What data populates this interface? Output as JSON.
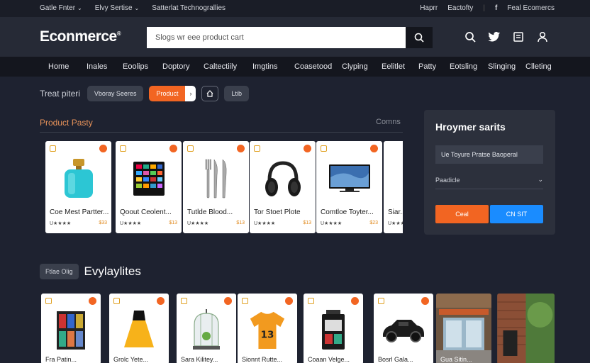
{
  "topbar": {
    "left": [
      {
        "label": "Gatle Fnter",
        "chevron": true
      },
      {
        "label": "Elvy Sertise",
        "chevron": true
      },
      {
        "label": "Satterlat Technograllies",
        "chevron": false
      }
    ],
    "right": {
      "link1": "Haprr",
      "link2": "Eactofty",
      "social": "Feal Ecomercs"
    }
  },
  "header": {
    "logo": "Econmerce",
    "logo_mark": "®",
    "search_placeholder": "Slogs wr eee product cart",
    "icons": [
      "search-icon",
      "twitter-icon",
      "cart-icon",
      "user-icon"
    ]
  },
  "nav": [
    "Home",
    "Inales",
    "Eoolips",
    "Doptory",
    "Caltectiily",
    "Imgtins",
    "Coasetood",
    "Clyping",
    "Eelitlet",
    "Patty",
    "Eotsling",
    "Slinging",
    "Clleting"
  ],
  "filters": {
    "label": "Treat piteri",
    "chips": [
      "Vboray Seeres",
      "Product"
    ],
    "arrow": "›",
    "last": "Ltib"
  },
  "section1": {
    "title": "Product Pasty",
    "more": "Comns",
    "products": [
      {
        "name": "Coe Mest Partter...",
        "stars": "U★★★★",
        "price": "$33",
        "icon": "perfume-bottle"
      },
      {
        "name": "Qoout Ceolent...",
        "stars": "U★★★★",
        "price": "$13",
        "icon": "tablet-device"
      },
      {
        "name": "Tutlde Blood...",
        "stars": "U★★★★",
        "price": "$13",
        "icon": "cutlery-set"
      },
      {
        "name": "Tor Stoet Plote",
        "stars": "U★★★★",
        "price": "$13",
        "icon": "headphones"
      },
      {
        "name": "Comtloe Toyter...",
        "stars": "U★★★★",
        "price": "$23",
        "icon": "television"
      },
      {
        "name": "Siar...",
        "stars": "U★★★★",
        "price": "",
        "icon": "yellow-item"
      }
    ]
  },
  "panel": {
    "title": "Hroymer sarits",
    "field": "Ue Toyure Pratse Baoperal",
    "select": "Paadicle",
    "btn_primary": "Ceal",
    "btn_secondary": "CN SIT"
  },
  "section2": {
    "badge": "Ftlae Olig",
    "title": "Evylaylites",
    "products": [
      {
        "name": "Fra Patin...",
        "icon": "book-stack"
      },
      {
        "name": "Grolc Yete...",
        "icon": "yellow-dress"
      },
      {
        "name": "Sara Kilitey...",
        "icon": "glass-terrarium"
      },
      {
        "name": "Sionnt Rutte...",
        "icon": "orange-jersey"
      },
      {
        "name": "Coaan Velge...",
        "icon": "gift-box"
      },
      {
        "name": "Bosrl Gala...",
        "icon": "black-car"
      },
      {
        "name": "Gua Sitin...",
        "icon": "storefront"
      },
      {
        "name": "",
        "icon": "brick-wall"
      }
    ]
  }
}
